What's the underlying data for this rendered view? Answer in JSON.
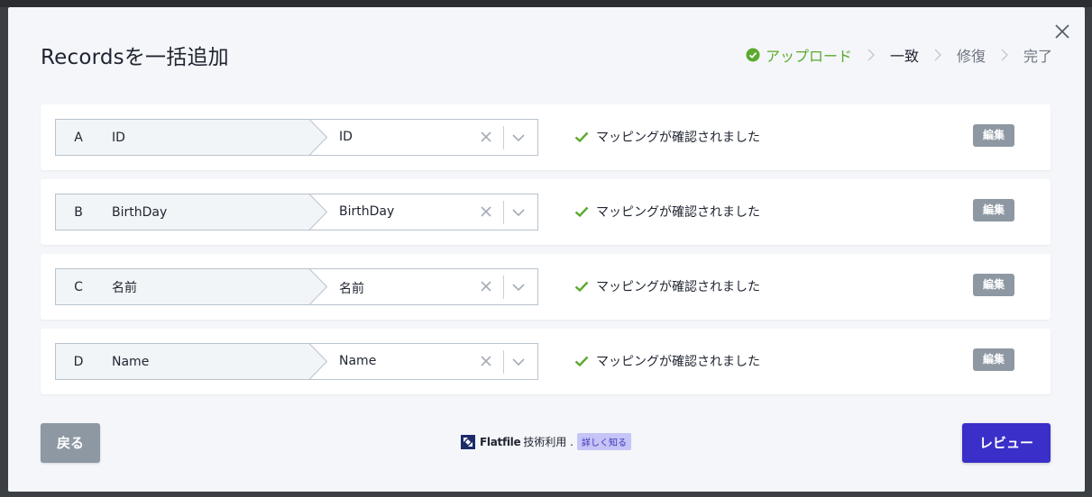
{
  "modal": {
    "title": "Recordsを一括追加",
    "close_icon": "close-icon"
  },
  "steps": [
    {
      "label": "アップロード",
      "state": "done"
    },
    {
      "label": "一致",
      "state": "current"
    },
    {
      "label": "修復",
      "state": "pending"
    },
    {
      "label": "完了",
      "state": "pending"
    }
  ],
  "rows": [
    {
      "letter": "A",
      "source": "ID",
      "target": "ID",
      "status": "マッピングが確認されました",
      "edit": "編集"
    },
    {
      "letter": "B",
      "source": "BirthDay",
      "target": "BirthDay",
      "status": "マッピングが確認されました",
      "edit": "編集"
    },
    {
      "letter": "C",
      "source": "名前",
      "target": "名前",
      "status": "マッピングが確認されました",
      "edit": "編集"
    },
    {
      "letter": "D",
      "source": "Name",
      "target": "Name",
      "status": "マッピングが確認されました",
      "edit": "編集"
    }
  ],
  "footer": {
    "back_label": "戻る",
    "brand": "Flatfile",
    "tech_text": "技術利用 .",
    "learn_more": "詳しく知る",
    "review_label": "レビュー"
  },
  "colors": {
    "accent": "#3a2fc8",
    "success": "#5ba92e",
    "neutral_button": "#8d98a3"
  }
}
